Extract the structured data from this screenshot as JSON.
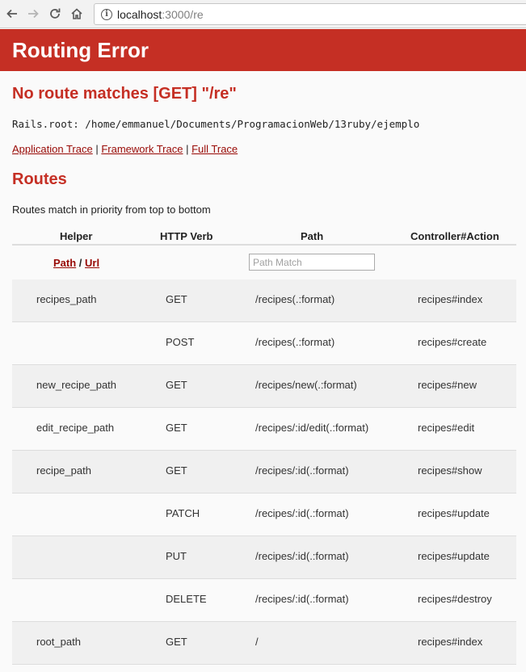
{
  "browser": {
    "url_host": "localhost",
    "url_rest": ":3000/re"
  },
  "page": {
    "title": "Routing Error",
    "message": "No route matches [GET] \"/re\"",
    "rails_root": "Rails.root: /home/emmanuel/Documents/ProgramacionWeb/13ruby/ejemplo",
    "trace_links": [
      "Application Trace",
      "Framework Trace",
      "Full Trace"
    ],
    "routes_heading": "Routes",
    "routes_description": "Routes match in priority from top to bottom"
  },
  "routes_table": {
    "headers": [
      "Helper",
      "HTTP Verb",
      "Path",
      "Controller#Action"
    ],
    "filter": {
      "path_link": "Path",
      "separator": "/",
      "url_link": "Url",
      "placeholder": "Path Match"
    },
    "rows": [
      {
        "helper": "recipes_path",
        "verb": "GET",
        "path": "/recipes(.:format)",
        "action": "recipes#index"
      },
      {
        "helper": "",
        "verb": "POST",
        "path": "/recipes(.:format)",
        "action": "recipes#create"
      },
      {
        "helper": "new_recipe_path",
        "verb": "GET",
        "path": "/recipes/new(.:format)",
        "action": "recipes#new"
      },
      {
        "helper": "edit_recipe_path",
        "verb": "GET",
        "path": "/recipes/:id/edit(.:format)",
        "action": "recipes#edit"
      },
      {
        "helper": "recipe_path",
        "verb": "GET",
        "path": "/recipes/:id(.:format)",
        "action": "recipes#show"
      },
      {
        "helper": "",
        "verb": "PATCH",
        "path": "/recipes/:id(.:format)",
        "action": "recipes#update"
      },
      {
        "helper": "",
        "verb": "PUT",
        "path": "/recipes/:id(.:format)",
        "action": "recipes#update"
      },
      {
        "helper": "",
        "verb": "DELETE",
        "path": "/recipes/:id(.:format)",
        "action": "recipes#destroy"
      },
      {
        "helper": "root_path",
        "verb": "GET",
        "path": "/",
        "action": "recipes#index"
      }
    ]
  },
  "colors": {
    "banner": "#c52f24",
    "heading": "#c52f24",
    "link": "#980905",
    "row_alt": "#f0f0f0"
  }
}
